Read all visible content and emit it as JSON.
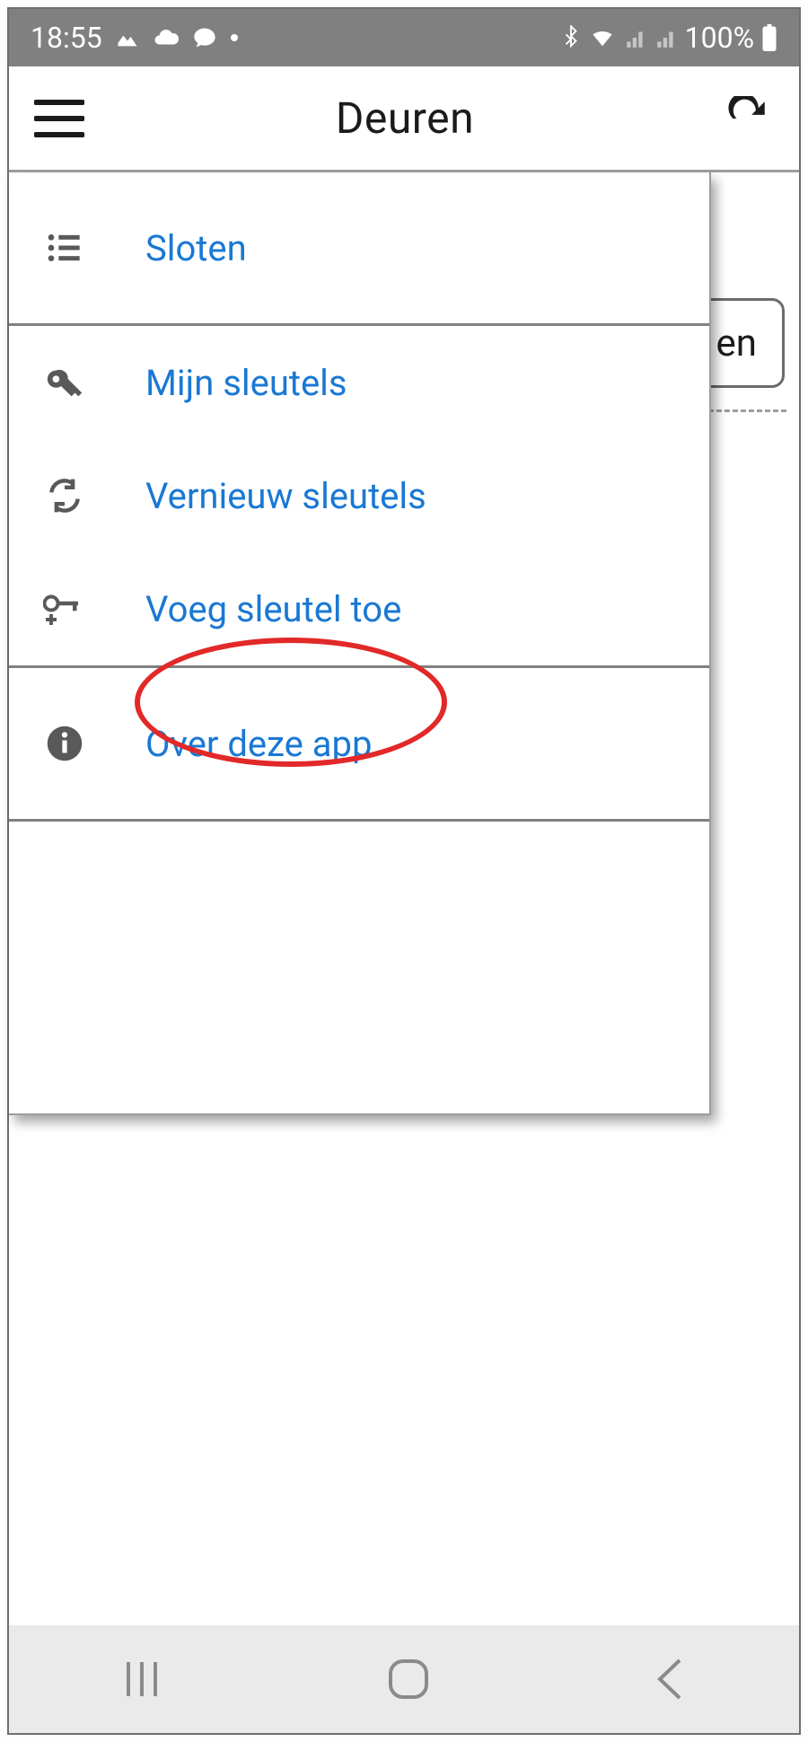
{
  "status_bar": {
    "time": "18:55",
    "battery_pct": "100%"
  },
  "header": {
    "title": "Deuren"
  },
  "background": {
    "button_visible_fragment": "en"
  },
  "drawer": {
    "section_locks": {
      "label": "Sloten"
    },
    "section_keys": {
      "my_keys": "Mijn sleutels",
      "refresh_keys": "Vernieuw sleutels",
      "add_key": "Voeg sleutel toe"
    },
    "section_about": {
      "label": "Over deze app"
    }
  },
  "colors": {
    "accent": "#1a78d4",
    "highlight": "#e22828",
    "status_bg": "#808080"
  }
}
